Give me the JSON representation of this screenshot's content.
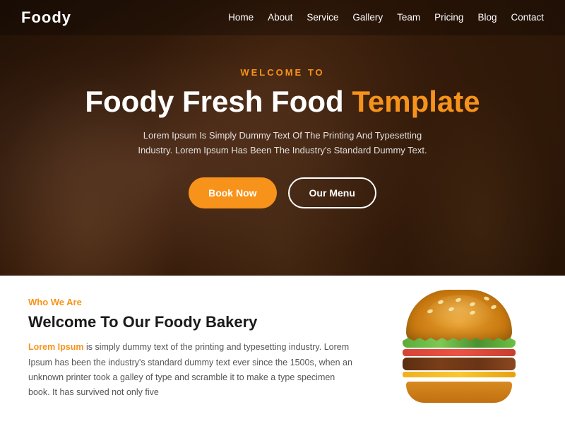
{
  "brand": {
    "logo": "Foody"
  },
  "nav": {
    "links": [
      {
        "label": "Home",
        "href": "#"
      },
      {
        "label": "About",
        "href": "#"
      },
      {
        "label": "Service",
        "href": "#"
      },
      {
        "label": "Gallery",
        "href": "#"
      },
      {
        "label": "Team",
        "href": "#"
      },
      {
        "label": "Pricing",
        "href": "#"
      },
      {
        "label": "Blog",
        "href": "#"
      },
      {
        "label": "Contact",
        "href": "#"
      }
    ]
  },
  "hero": {
    "subtitle": "Welcome To",
    "title_white": "Foody Fresh Food",
    "title_orange": "Template",
    "description": "Lorem Ipsum Is Simply Dummy Text Of The Printing And Typesetting Industry. Lorem Ipsum Has Been The Industry's Standard Dummy Text.",
    "btn_book": "Book Now",
    "btn_menu": "Our Menu"
  },
  "about": {
    "who_label": "Who We Are",
    "title": "Welcome To Our Foody Bakery",
    "description_part1": "Lorem Ipsum",
    "description_part2": " is simply dummy text of the printing and typesetting industry. Lorem Ipsum has been the industry's standard dummy text ever since the 1500s, when an unknown printer took a galley of type and scramble it to make a type specimen book. It has survived not only five"
  }
}
